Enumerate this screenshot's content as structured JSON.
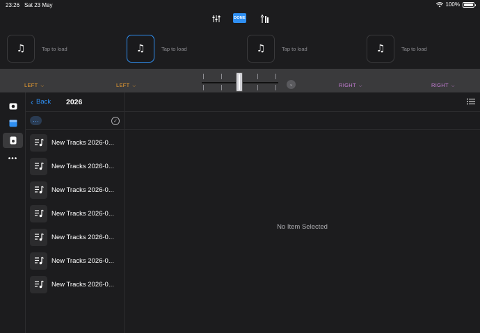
{
  "status_bar": {
    "time": "23:26",
    "date": "Sat 23 May",
    "battery": "100%"
  },
  "toolbar": {
    "done_label": "DONE"
  },
  "decks": [
    {
      "tap_label": "Tap to load",
      "active": false
    },
    {
      "tap_label": "Tap to load",
      "active": true
    },
    {
      "tap_label": "Tap to load",
      "active": false
    },
    {
      "tap_label": "Tap to load",
      "active": false
    }
  ],
  "mixer": {
    "left_label_1": "LEFT",
    "left_label_2": "LEFT",
    "right_label_1": "RIGHT",
    "right_label_2": "RIGHT",
    "left_color": "#f0a030",
    "right_color": "#c67ed6"
  },
  "browser": {
    "back_label": "Back",
    "folder_title": "2026",
    "items": [
      {
        "label": "New Tracks 2026-0..."
      },
      {
        "label": "New Tracks 2026-0..."
      },
      {
        "label": "New Tracks 2026-0..."
      },
      {
        "label": "New Tracks 2026-0..."
      },
      {
        "label": "New Tracks 2026-0..."
      },
      {
        "label": "New Tracks 2026-0..."
      },
      {
        "label": "New Tracks 2026-0..."
      }
    ]
  },
  "detail": {
    "empty_text": "No Item Selected"
  },
  "colors": {
    "accent": "#2f8ff2",
    "background": "#1c1c1e"
  }
}
